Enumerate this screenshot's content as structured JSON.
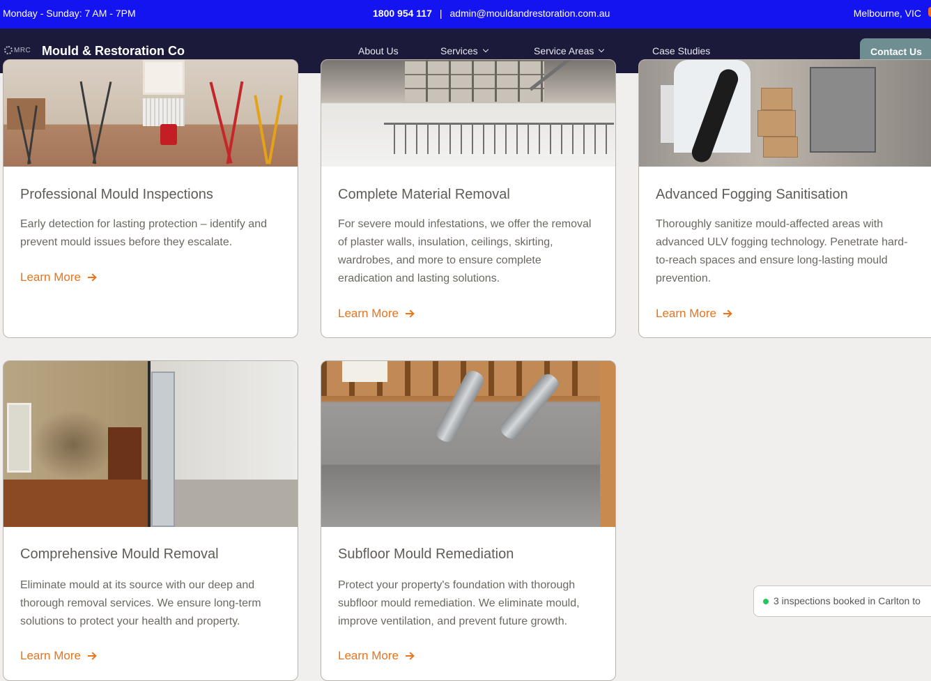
{
  "topbar": {
    "hours": "Monday - Sunday: 7 AM - 7PM",
    "phone": "1800 954 117",
    "separator": "|",
    "email": "admin@mouldandrestoration.com.au",
    "location": "Melbourne, VIC"
  },
  "nav": {
    "logo_text": "MRC",
    "brand": "Mould & Restoration Co",
    "items": [
      {
        "label": "About Us"
      },
      {
        "label": "Services"
      },
      {
        "label": "Service Areas"
      },
      {
        "label": "Case Studies"
      }
    ],
    "cta": "Contact Us"
  },
  "cards": [
    {
      "title": "Professional Mould Inspections",
      "text": "Early detection for lasting protection – identify and prevent mould issues before they escalate.",
      "link": "Learn More"
    },
    {
      "title": "Complete Material Removal",
      "text": "For severe mould infestations, we offer the removal of plaster walls, insulation, ceilings, skirting, wardrobes, and more to ensure complete eradication and lasting solutions.",
      "link": "Learn More"
    },
    {
      "title": "Advanced Fogging Sanitisation",
      "text": "Thoroughly sanitize mould-affected areas with advanced ULV fogging technology. Penetrate hard-to-reach spaces and ensure long-lasting mould prevention.",
      "link": "Learn More"
    },
    {
      "title": "Comprehensive Mould Removal",
      "text": "Eliminate mould at its source with our deep and thorough removal services. We ensure long-term solutions to protect your health and property.",
      "link": "Learn More"
    },
    {
      "title": "Subfloor Mould Remediation",
      "text": "Protect your property's foundation with thorough subfloor mould remediation. We eliminate mould, improve ventilation, and prevent future growth.",
      "link": "Learn More"
    }
  ],
  "toast": {
    "text": "3 inspections booked in Carlton to"
  },
  "colors": {
    "topbar": "#1414f0",
    "nav": "#1b1a3a",
    "accent": "#e8731b",
    "cta": "#6f8e92"
  }
}
